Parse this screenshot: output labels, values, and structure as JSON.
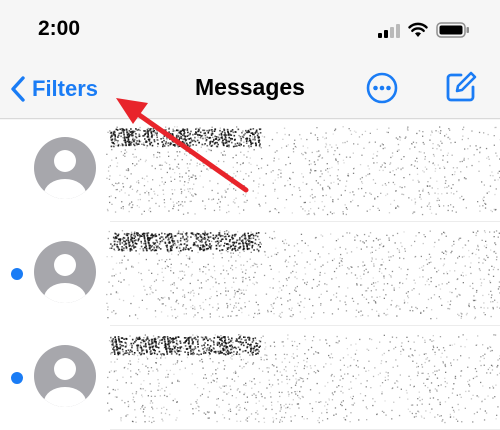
{
  "status_bar": {
    "time": "2:00",
    "icons": [
      "signal-icon",
      "wifi-icon",
      "battery-icon"
    ]
  },
  "navbar": {
    "back_label": "Filters",
    "title": "Messages",
    "icons": {
      "back": "chevron-left-icon",
      "more": "ellipsis-circle-icon",
      "compose": "compose-icon"
    }
  },
  "conversations": [
    {
      "unread": false
    },
    {
      "unread": true
    },
    {
      "unread": true
    }
  ],
  "annotation": {
    "type": "red-arrow",
    "points_to": "back-button"
  },
  "colors": {
    "accent": "#1a7cf5",
    "avatar_gray": "#a7a7ac",
    "annotation": "#e8242b"
  }
}
